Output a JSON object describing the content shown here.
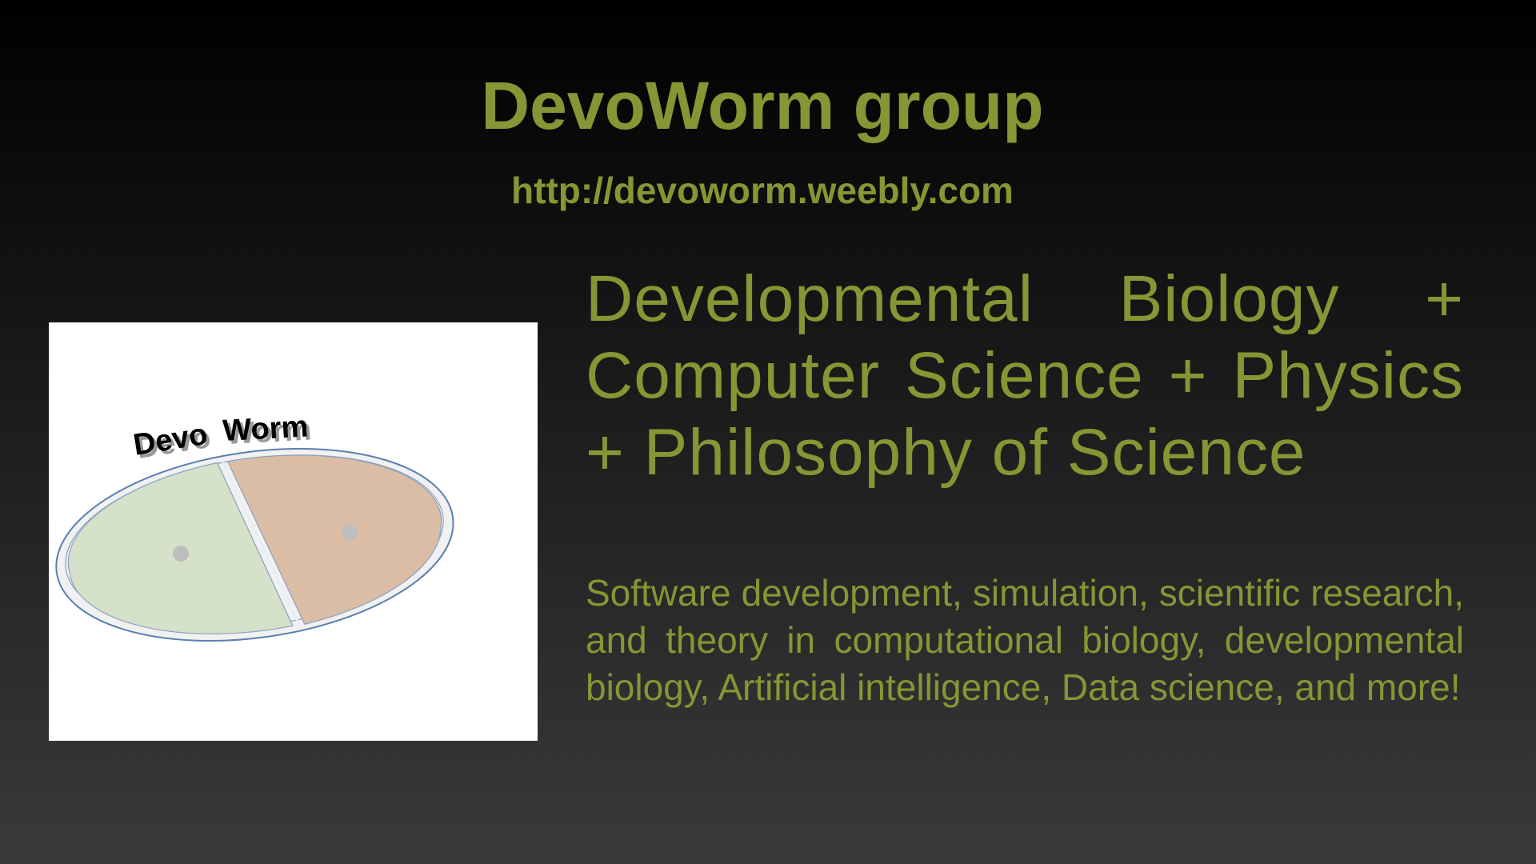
{
  "slide": {
    "title": "DevoWorm group",
    "url": "http://devoworm.weebly.com",
    "headline": "Developmental Biology + Computer Science + Physics + Philosophy of Science",
    "description": "Software development, simulation, scientific research, and theory in computational biology, developmental biology, Artificial intelligence, Data science, and more!",
    "logo_text": "Devo Worm"
  },
  "colors": {
    "text": "#869634",
    "background_top": "#000000",
    "background_bottom": "#3a3a3a",
    "logo_left_cell": "#d5e1c8",
    "logo_right_cell": "#dbbca4"
  }
}
